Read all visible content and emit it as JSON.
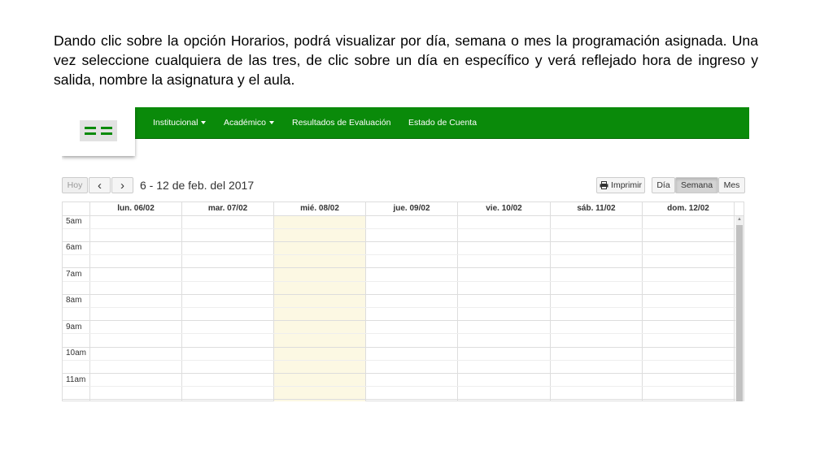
{
  "intro_text": "Dando clic sobre la opción Horarios, podrá visualizar por día, semana o mes  la programación asignada. Una vez seleccione cualquiera de las tres, de clic sobre  un día en específico y verá reflejado hora de ingreso y salida, nombre la asignatura y el aula.",
  "navbar": {
    "items": [
      {
        "label": "Institucional",
        "dropdown": true
      },
      {
        "label": "Académico",
        "dropdown": true
      },
      {
        "label": "Resultados de Evaluación",
        "dropdown": false
      },
      {
        "label": "Estado de Cuenta",
        "dropdown": false
      }
    ],
    "color": "#0a8a0a"
  },
  "toolbar": {
    "today_label": "Hoy",
    "prev_icon": "‹",
    "next_icon": "›",
    "date_range": "6 - 12 de feb. del 2017",
    "print_label": "Imprimir",
    "views": [
      {
        "label": "Día",
        "active": false
      },
      {
        "label": "Semana",
        "active": true
      },
      {
        "label": "Mes",
        "active": false
      }
    ]
  },
  "calendar": {
    "days": [
      "lun. 06/02",
      "mar. 07/02",
      "mié. 08/02",
      "jue. 09/02",
      "vie. 10/02",
      "sáb. 11/02",
      "dom. 12/02"
    ],
    "today_index": 2,
    "today_color": "#fcf8e3",
    "times": [
      "5am",
      "6am",
      "7am",
      "8am",
      "9am",
      "10am",
      "11am"
    ]
  }
}
